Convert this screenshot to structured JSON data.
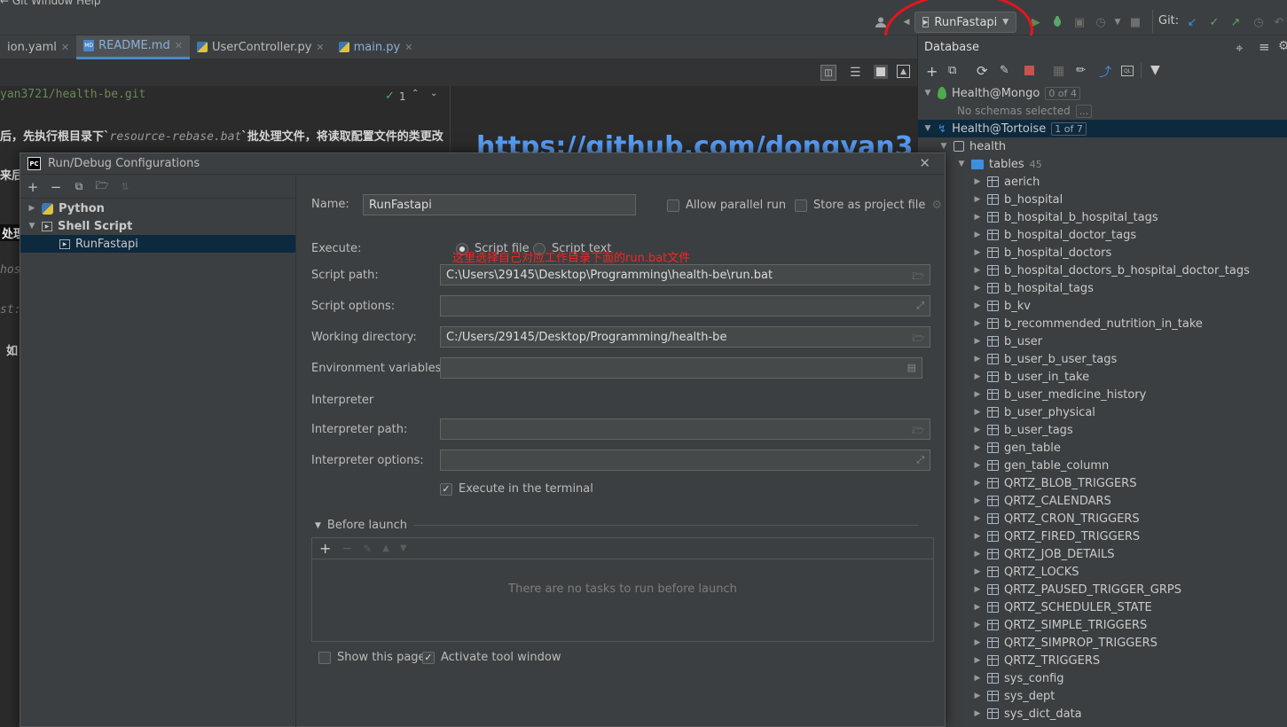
{
  "toolbar": {
    "menu_hint": "  ← Git   Window  Help",
    "run_config": "RunFastapi",
    "git_label": "Git:"
  },
  "tabs": [
    {
      "label": "ion.yaml",
      "active": false
    },
    {
      "label": "README.md",
      "active": true
    },
    {
      "label": "UserController.py",
      "active": false
    },
    {
      "label": "main.py",
      "active": false
    }
  ],
  "editor": {
    "line1": "yan3721/health-be.git",
    "check_count": "1",
    "line2_pre": "后，先执行根目录下`",
    "line2_code": "resource-rebase.bat",
    "line2_post": "`批处理文件，将读取配置文件的类更改",
    "line3": "来后",
    "line4": "处理",
    "line5": "hos",
    "line6": "st:",
    "line7": "如",
    "preview_url": "https://github.com/dongyan3"
  },
  "database": {
    "title": "Database",
    "mongo": {
      "name": "Health@Mongo",
      "count": "0 of 4",
      "note": "No schemas selected",
      "more": "..."
    },
    "tortoise": {
      "name": "Health@Tortoise",
      "count": "1 of 7"
    },
    "schema": "health",
    "tables_label": "tables",
    "tables_count": "45",
    "tables": [
      "aerich",
      "b_hospital",
      "b_hospital_b_hospital_tags",
      "b_hospital_doctor_tags",
      "b_hospital_doctors",
      "b_hospital_doctors_b_hospital_doctor_tags",
      "b_hospital_tags",
      "b_kv",
      "b_recommended_nutrition_in_take",
      "b_user",
      "b_user_b_user_tags",
      "b_user_in_take",
      "b_user_medicine_history",
      "b_user_physical",
      "b_user_tags",
      "gen_table",
      "gen_table_column",
      "QRTZ_BLOB_TRIGGERS",
      "QRTZ_CALENDARS",
      "QRTZ_CRON_TRIGGERS",
      "QRTZ_FIRED_TRIGGERS",
      "QRTZ_JOB_DETAILS",
      "QRTZ_LOCKS",
      "QRTZ_PAUSED_TRIGGER_GRPS",
      "QRTZ_SCHEDULER_STATE",
      "QRTZ_SIMPLE_TRIGGERS",
      "QRTZ_SIMPROP_TRIGGERS",
      "QRTZ_TRIGGERS",
      "sys_config",
      "sys_dept",
      "sys_dict_data"
    ]
  },
  "dialog": {
    "title": "Run/Debug Configurations",
    "pc_icon": "PC",
    "tree": {
      "python": "Python",
      "shell": "Shell Script",
      "config": "RunFastapi"
    },
    "name_label": "Name:",
    "name_value": "RunFastapi",
    "allow_parallel": "Allow parallel run",
    "store_project": "Store as project file",
    "execute_label": "Execute:",
    "script_file": "Script file",
    "script_text": "Script text",
    "annotation": "这里选择自己对应工作目录下面的run.bat文件",
    "script_path_label": "Script path:",
    "script_path_value": "C:\\Users\\29145\\Desktop\\Programming\\health-be\\run.bat",
    "script_options_label": "Script options:",
    "working_dir_label": "Working directory:",
    "working_dir_value": "C:/Users/29145/Desktop/Programming/health-be",
    "env_label": "Environment variables:",
    "interpreter_section": "Interpreter",
    "interp_path_label": "Interpreter path:",
    "interp_options_label": "Interpreter options:",
    "exec_terminal": "Execute in the terminal",
    "before_launch": "Before launch",
    "no_tasks": "There are no tasks to run before launch",
    "show_page": "Show this page",
    "activate_tool": "Activate tool window"
  }
}
